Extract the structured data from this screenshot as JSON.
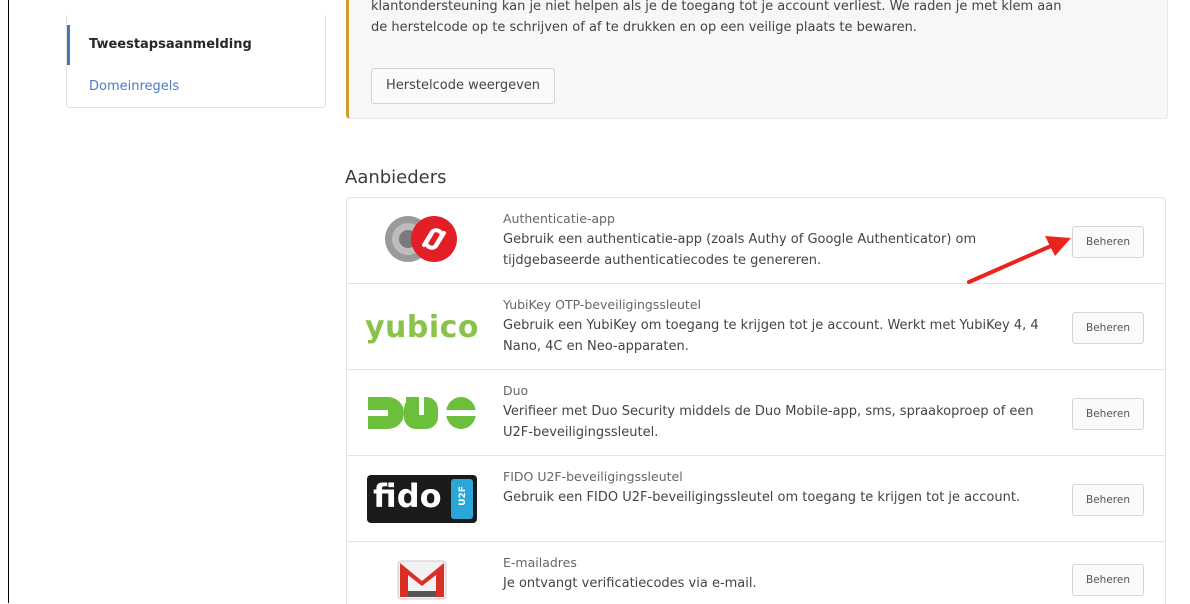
{
  "sidebar": {
    "items": [
      {
        "label": "Tweestapsaanmelding",
        "active": true
      },
      {
        "label": "Domeinregels",
        "active": false
      }
    ]
  },
  "warning": {
    "lines": [
      "klantondersteuning kan je niet helpen als je de toegang tot je account verliest. We raden je met klem aan",
      "de herstelcode op te schrijven of af te drukken en op een veilige plaats te bewaren."
    ],
    "button_label": "Herstelcode weergeven",
    "accent_color": "#d29b2c"
  },
  "providers_section": {
    "title": "Aanbieders",
    "items": [
      {
        "title": "Authenticatie-app",
        "description": "Gebruik een authenticatie-app (zoals Authy of Google Authenticator) om tijdgebaseerde authenticatiecodes te genereren.",
        "button_label": "Beheren",
        "logo_icon": "authenticator-logo"
      },
      {
        "title": "YubiKey OTP-beveiligingssleutel",
        "description": "Gebruik een YubiKey om toegang te krijgen tot je account. Werkt met YubiKey 4, 4 Nano, 4C en Neo-apparaten.",
        "button_label": "Beheren",
        "logo_text": "yubico",
        "logo_color": "#8bc34a"
      },
      {
        "title": "Duo",
        "description": "Verifieer met Duo Security middels de Duo Mobile-app, sms, spraakoproep of een U2F-beveiligingssleutel.",
        "button_label": "Beheren",
        "logo_icon": "duo-logo",
        "logo_color": "#6bbf3b"
      },
      {
        "title": "FIDO U2F-beveiligingssleutel",
        "description": "Gebruik een FIDO U2F-beveiligingssleutel om toegang te krijgen tot je account.",
        "button_label": "Beheren",
        "logo_text": "fido",
        "logo_badge": "U2F"
      },
      {
        "title": "E-mailadres",
        "description": "Je ontvangt verificatiecodes via e-mail.",
        "button_label": "Beheren",
        "logo_icon": "gmail-logo"
      }
    ]
  },
  "annotation": {
    "icon": "red-arrow-icon",
    "color": "#e8241c"
  }
}
